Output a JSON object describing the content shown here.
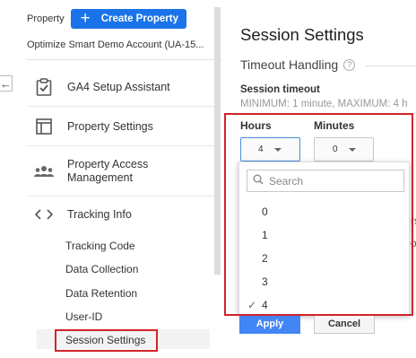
{
  "property": {
    "label": "Property",
    "create_button": "Create Property",
    "account_name": "Optimize Smart Demo Account (UA-15..."
  },
  "nav": {
    "items": [
      {
        "label": "GA4 Setup Assistant",
        "icon": "clipboard-check-icon"
      },
      {
        "label": "Property Settings",
        "icon": "window-layout-icon"
      },
      {
        "label": "Property Access Management",
        "icon": "people-group-icon"
      },
      {
        "label": "Tracking Info",
        "icon": "code-brackets-icon"
      }
    ],
    "tracking_subitems": [
      "Tracking Code",
      "Data Collection",
      "Data Retention",
      "User-ID",
      "Session Settings"
    ]
  },
  "main": {
    "title": "Session Settings",
    "section_title": "Timeout Handling",
    "help_glyph": "?",
    "session_timeout_label": "Session timeout",
    "session_timeout_desc": "MINIMUM: 1 minute, MAXIMUM: 4 h",
    "hours_label": "Hours",
    "minutes_label": "Minutes",
    "hours_value": "4",
    "minutes_value": "0",
    "apply_label": "Apply",
    "cancel_label": "Cancel",
    "fragment_1": "rs",
    "fragment_2": "o"
  },
  "hours_dropdown": {
    "search_placeholder": "Search",
    "options": [
      "0",
      "1",
      "2",
      "3",
      "4"
    ],
    "selected": "4",
    "check_glyph": "✓"
  },
  "colors": {
    "primary_button": "#1a73e8",
    "apply_button": "#4285f4",
    "highlight_box": "#d1232b"
  }
}
